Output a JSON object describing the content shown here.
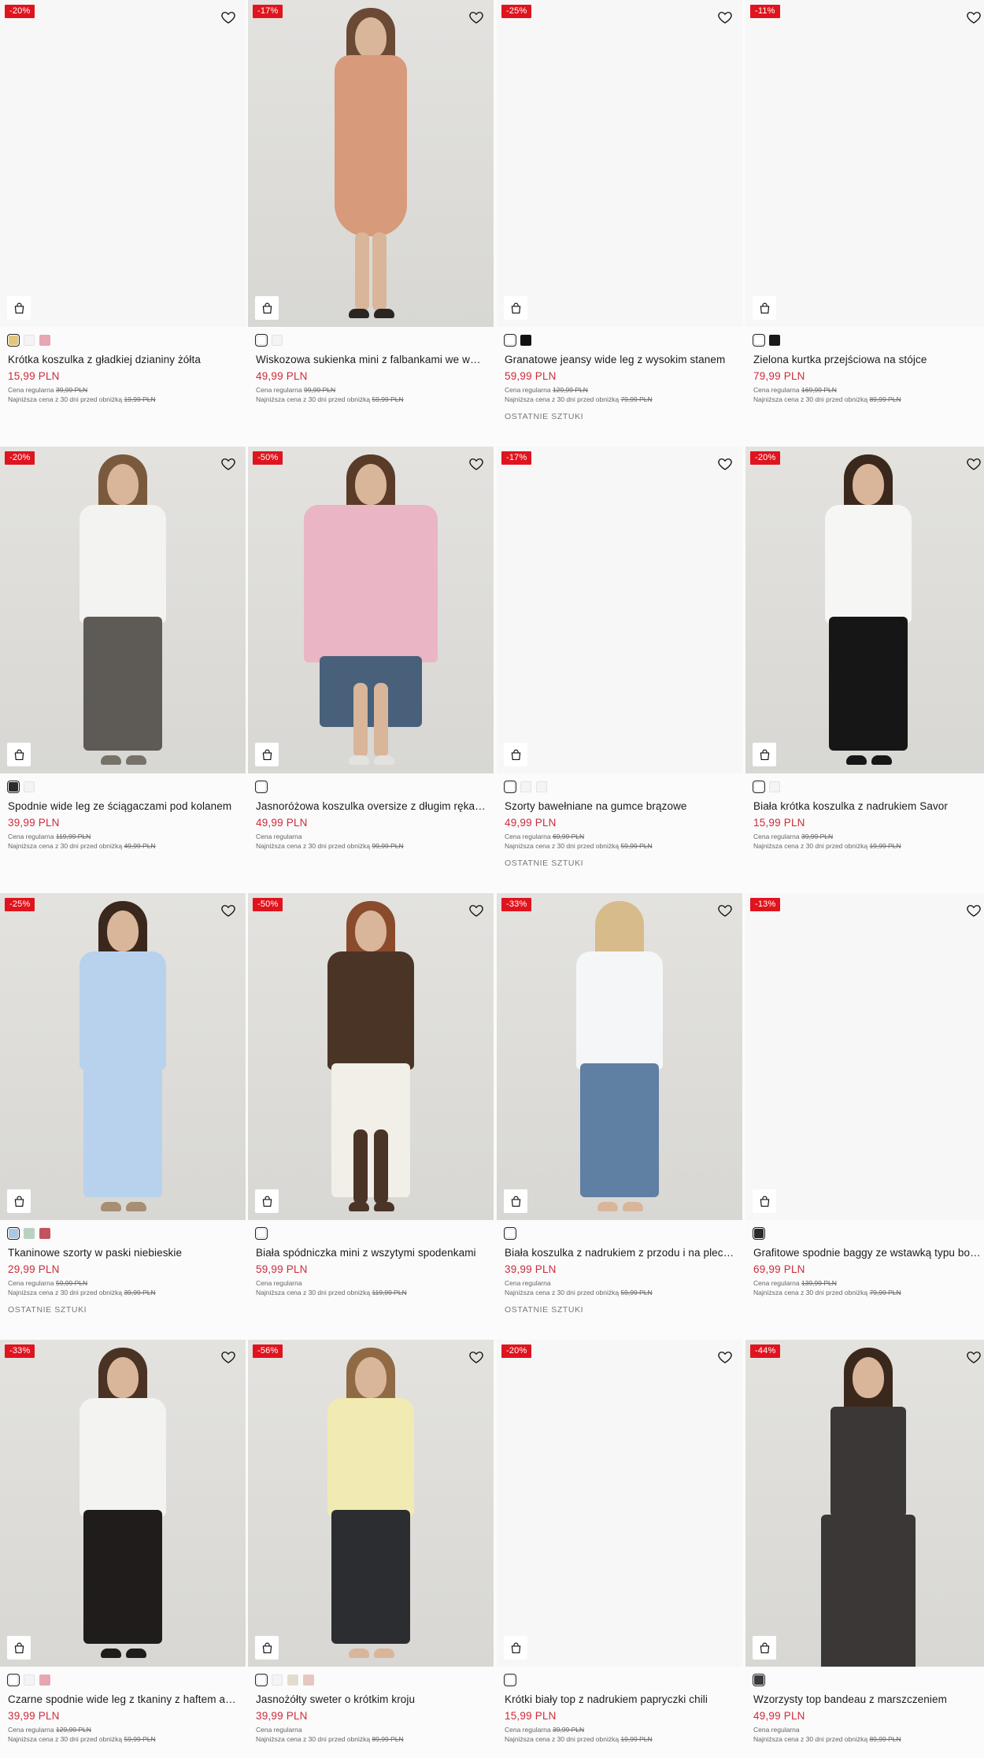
{
  "products": [
    {
      "name": "Krótka koszulka z gładkiej dzianiny żółta",
      "price": "15,99 PLN",
      "discount": "-20%",
      "regular_label": "Cena regularna",
      "regular_price": "39,99 PLN",
      "lowest_label": "Najniższa cena z 30 dni przed obniżką",
      "lowest_price": "19,99 PLN",
      "last": "",
      "swatches": [
        "#e4c67a",
        "#f4f4f4",
        "#e7a6b2"
      ],
      "photo": false
    },
    {
      "name": "Wiskozowa sukienka mini z falbankami we wzory",
      "price": "49,99 PLN",
      "discount": "-17%",
      "regular_label": "Cena regularna",
      "regular_price": "99,99 PLN",
      "lowest_label": "Najniższa cena z 30 dni przed obniżką",
      "lowest_price": "59,99 PLN",
      "last": "",
      "swatches": [
        "#ffffff",
        "#f4f4f4"
      ],
      "photo": true,
      "look": {
        "hair": "#6b4a35",
        "top": "#d79a7a",
        "bottom": "#d9a07e",
        "shoe": "#2b2522",
        "dress": true
      }
    },
    {
      "name": "Granatowe jeansy wide leg z wysokim stanem",
      "price": "59,99 PLN",
      "discount": "-25%",
      "regular_label": "Cena regularna",
      "regular_price": "129,99 PLN",
      "lowest_label": "Najniższa cena z 30 dni przed obniżką",
      "lowest_price": "79,99 PLN",
      "last": "OSTATNIE SZTUKI",
      "swatches": [
        "#ffffff",
        "#111111"
      ],
      "photo": false
    },
    {
      "name": "Zielona kurtka przejściowa na stójce",
      "price": "79,99 PLN",
      "discount": "-11%",
      "regular_label": "Cena regularna",
      "regular_price": "169,99 PLN",
      "lowest_label": "Najniższa cena z 30 dni przed obniżką",
      "lowest_price": "89,99 PLN",
      "last": "",
      "swatches": [
        "#ffffff",
        "#1a1a1a"
      ],
      "photo": false
    },
    {
      "name": "Spodnie wide leg ze ściągaczami pod kolanem",
      "price": "39,99 PLN",
      "discount": "-20%",
      "regular_label": "Cena regularna",
      "regular_price": "119,99 PLN",
      "lowest_label": "Najniższa cena z 30 dni przed obniżką",
      "lowest_price": "49,99 PLN",
      "last": "",
      "swatches": [
        "#2b2b2b",
        "#f4f4f4"
      ],
      "photo": true,
      "look": {
        "hair": "#7a5a3c",
        "top": "#f3f3f1",
        "bottom": "#5e5a56",
        "shoe": "#777269"
      }
    },
    {
      "name": "Jasnoróżowa koszulka oversize z długim rękawem",
      "price": "49,99 PLN",
      "discount": "-50%",
      "regular_label": "Cena regularna",
      "regular_price": "",
      "lowest_label": "Najniższa cena z 30 dni przed obniżką",
      "lowest_price": "99,99 PLN",
      "last": "",
      "swatches": [
        "#ffffff"
      ],
      "photo": true,
      "look": {
        "hair": "#5a3b28",
        "top": "#eab5c4",
        "bottom": "#48607a",
        "shoe": "#e3e2df",
        "wide": true
      }
    },
    {
      "name": "Szorty bawełniane na gumce brązowe",
      "price": "49,99 PLN",
      "discount": "-17%",
      "regular_label": "Cena regularna",
      "regular_price": "69,99 PLN",
      "lowest_label": "Najniższa cena z 30 dni przed obniżką",
      "lowest_price": "59,99 PLN",
      "last": "OSTATNIE SZTUKI",
      "swatches": [
        "#ffffff",
        "#f4f4f4",
        "#f4f4f4"
      ],
      "photo": false
    },
    {
      "name": "Biała krótka koszulka z nadrukiem Savor",
      "price": "15,99 PLN",
      "discount": "-20%",
      "regular_label": "Cena regularna",
      "regular_price": "39,99 PLN",
      "lowest_label": "Najniższa cena z 30 dni przed obniżką",
      "lowest_price": "19,99 PLN",
      "last": "",
      "swatches": [
        "#ffffff",
        "#f4f4f4"
      ],
      "photo": true,
      "look": {
        "hair": "#3a281c",
        "top": "#f6f6f5",
        "bottom": "#161616",
        "shoe": "#161616"
      }
    },
    {
      "name": "Tkaninowe szorty w paski niebieskie",
      "price": "29,99 PLN",
      "discount": "-25%",
      "regular_label": "Cena regularna",
      "regular_price": "59,99 PLN",
      "lowest_label": "Najniższa cena z 30 dni przed obniżką",
      "lowest_price": "39,99 PLN",
      "last": "OSTATNIE SZTUKI",
      "swatches": [
        "#a9c7e6",
        "#b9d1c2",
        "#c2545e"
      ],
      "photo": true,
      "look": {
        "hair": "#3b281d",
        "top": "#b8d2ee",
        "bottom": "#b8d2ee",
        "shoe": "#a88e72"
      }
    },
    {
      "name": "Biała spódniczka mini z wszytymi spodenkami",
      "price": "59,99 PLN",
      "discount": "-50%",
      "regular_label": "Cena regularna",
      "regular_price": "",
      "lowest_label": "Najniższa cena z 30 dni przed obniżką",
      "lowest_price": "119,99 PLN",
      "last": "",
      "swatches": [
        "#ffffff"
      ],
      "photo": true,
      "look": {
        "hair": "#8a4b2c",
        "top": "#4a3426",
        "bottom": "#f2efe9",
        "shoe": "#4a3426",
        "boots": true
      }
    },
    {
      "name": "Biała koszulka z nadrukiem z przodu i na plecach",
      "price": "39,99 PLN",
      "discount": "-33%",
      "regular_label": "Cena regularna",
      "regular_price": "",
      "lowest_label": "Najniższa cena z 30 dni przed obniżką",
      "lowest_price": "59,99 PLN",
      "last": "OSTATNIE SZTUKI",
      "swatches": [
        "#ffffff"
      ],
      "photo": true,
      "look": {
        "hair": "#d8bb8a",
        "top": "#f5f6f8",
        "bottom": "#5f7fa3",
        "shoe": "#d9b59a",
        "back": true
      }
    },
    {
      "name": "Grafitowe spodnie baggy ze wstawką typu bokserki",
      "price": "69,99 PLN",
      "discount": "-13%",
      "regular_label": "Cena regularna",
      "regular_price": "139,99 PLN",
      "lowest_label": "Najniższa cena z 30 dni przed obniżką",
      "lowest_price": "79,99 PLN",
      "last": "",
      "swatches": [
        "#2b2b2b"
      ],
      "photo": false
    },
    {
      "name": "Czarne spodnie wide leg z tkaniny z haftem angielskim",
      "price": "39,99 PLN",
      "discount": "-33%",
      "regular_label": "Cena regularna",
      "regular_price": "129,99 PLN",
      "lowest_label": "Najniższa cena z 30 dni przed obniżką",
      "lowest_price": "59,99 PLN",
      "last": "",
      "swatches": [
        "#ffffff",
        "#f4f4f4",
        "#e7a6b2"
      ],
      "photo": true,
      "look": {
        "hair": "#4a3224",
        "top": "#f3f3f1",
        "bottom": "#1f1c1b",
        "shoe": "#1f1c1b"
      }
    },
    {
      "name": "Jasnożółty sweter o krótkim kroju",
      "price": "39,99 PLN",
      "discount": "-56%",
      "regular_label": "Cena regularna",
      "regular_price": "",
      "lowest_label": "Najniższa cena z 30 dni przed obniżką",
      "lowest_price": "89,99 PLN",
      "last": "",
      "swatches": [
        "#ffffff",
        "#f4f4f4",
        "#e2dccf",
        "#e6c7bf"
      ],
      "photo": true,
      "look": {
        "hair": "#8f6a45",
        "top": "#f1eab2",
        "bottom": "#2c2d31",
        "shoe": "#d9b59a"
      }
    },
    {
      "name": "Krótki biały top z nadrukiem papryczki chili",
      "price": "15,99 PLN",
      "discount": "-20%",
      "regular_label": "Cena regularna",
      "regular_price": "39,99 PLN",
      "lowest_label": "Najniższa cena z 30 dni przed obniżką",
      "lowest_price": "19,99 PLN",
      "last": "",
      "swatches": [
        "#ffffff"
      ],
      "photo": false
    },
    {
      "name": "Wzorzysty top bandeau z marszczeniem",
      "price": "49,99 PLN",
      "discount": "-44%",
      "regular_label": "Cena regularna",
      "regular_price": "",
      "lowest_label": "Najniższa cena z 30 dni przed obniżką",
      "lowest_price": "89,99 PLN",
      "last": "",
      "swatches": [
        "#3a3a3a"
      ],
      "photo": true,
      "look": {
        "hair": "#3b281d",
        "top": "#3a3736",
        "bottom": "#3a3736",
        "shoe": "#3a3736",
        "bandeau": true
      }
    }
  ]
}
